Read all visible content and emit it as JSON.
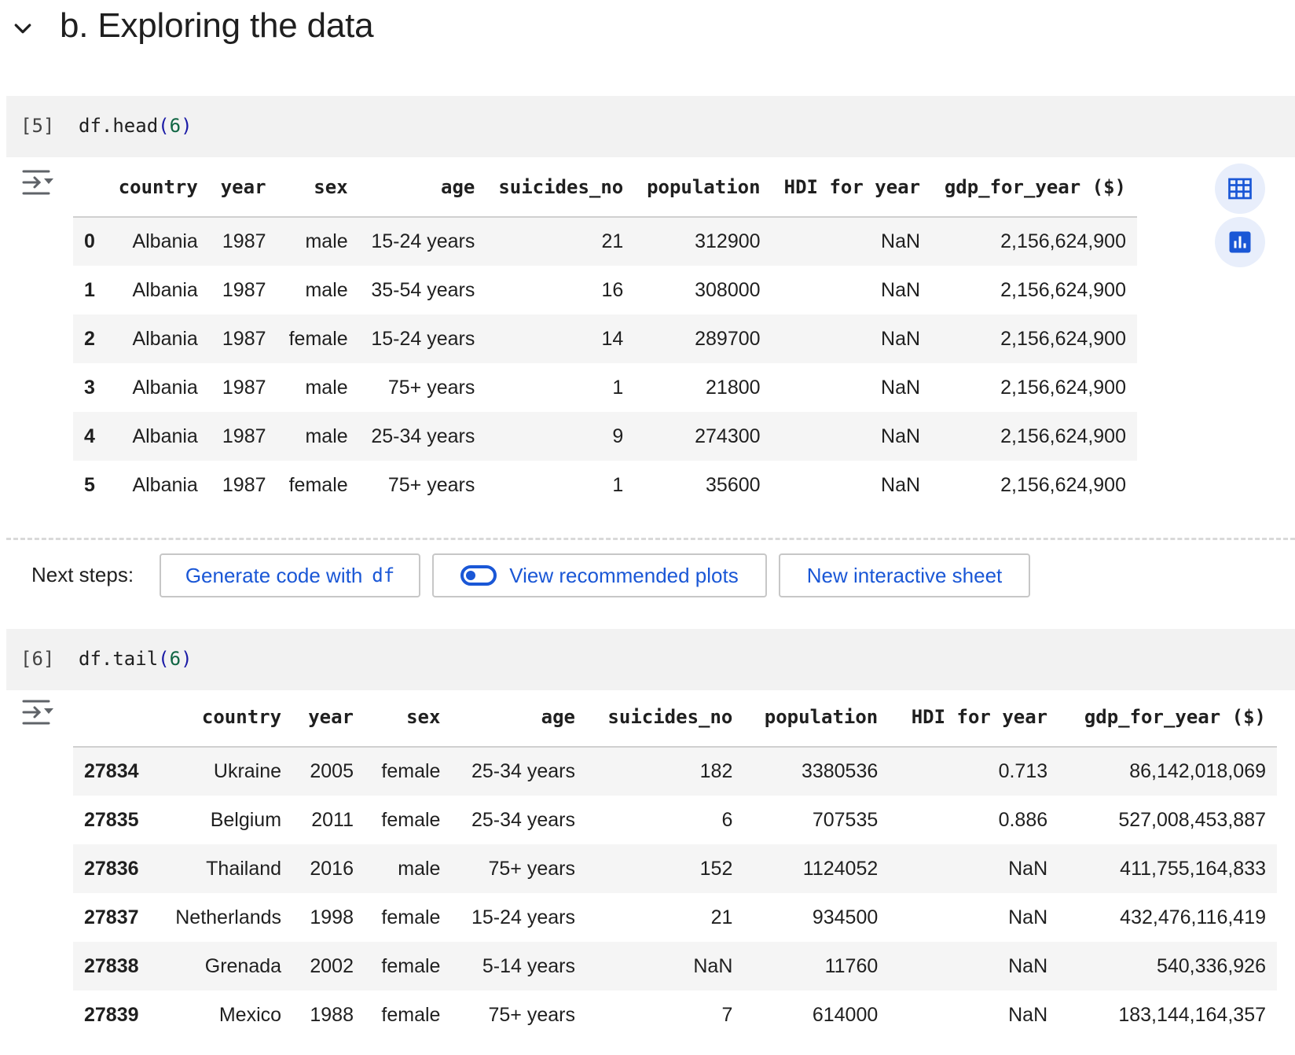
{
  "section": {
    "title": "b. Exploring the data"
  },
  "cells": [
    {
      "exec_count": "[5]",
      "code": {
        "obj": "df",
        "method": "head",
        "arg": "6"
      },
      "table": {
        "columns": [
          "",
          "country",
          "year",
          "sex",
          "age",
          "suicides_no",
          "population",
          "HDI for year",
          "gdp_for_year ($)"
        ],
        "rows": [
          [
            "0",
            "Albania",
            "1987",
            "male",
            "15-24 years",
            "21",
            "312900",
            "NaN",
            "2,156,624,900"
          ],
          [
            "1",
            "Albania",
            "1987",
            "male",
            "35-54 years",
            "16",
            "308000",
            "NaN",
            "2,156,624,900"
          ],
          [
            "2",
            "Albania",
            "1987",
            "female",
            "15-24 years",
            "14",
            "289700",
            "NaN",
            "2,156,624,900"
          ],
          [
            "3",
            "Albania",
            "1987",
            "male",
            "75+ years",
            "1",
            "21800",
            "NaN",
            "2,156,624,900"
          ],
          [
            "4",
            "Albania",
            "1987",
            "male",
            "25-34 years",
            "9",
            "274300",
            "NaN",
            "2,156,624,900"
          ],
          [
            "5",
            "Albania",
            "1987",
            "female",
            "75+ years",
            "1",
            "35600",
            "NaN",
            "2,156,624,900"
          ]
        ]
      }
    },
    {
      "exec_count": "[6]",
      "code": {
        "obj": "df",
        "method": "tail",
        "arg": "6"
      },
      "table": {
        "columns": [
          "",
          "country",
          "year",
          "sex",
          "age",
          "suicides_no",
          "population",
          "HDI for year",
          "gdp_for_year ($)"
        ],
        "rows": [
          [
            "27834",
            "Ukraine",
            "2005",
            "female",
            "25-34 years",
            "182",
            "3380536",
            "0.713",
            "86,142,018,069"
          ],
          [
            "27835",
            "Belgium",
            "2011",
            "female",
            "25-34 years",
            "6",
            "707535",
            "0.886",
            "527,008,453,887"
          ],
          [
            "27836",
            "Thailand",
            "2016",
            "male",
            "75+ years",
            "152",
            "1124052",
            "NaN",
            "411,755,164,833"
          ],
          [
            "27837",
            "Netherlands",
            "1998",
            "female",
            "15-24 years",
            "21",
            "934500",
            "NaN",
            "432,476,116,419"
          ],
          [
            "27838",
            "Grenada",
            "2002",
            "female",
            "5-14 years",
            "NaN",
            "11760",
            "NaN",
            "540,336,926"
          ],
          [
            "27839",
            "Mexico",
            "1988",
            "female",
            "75+ years",
            "7",
            "614000",
            "NaN",
            "183,144,164,357"
          ]
        ]
      }
    }
  ],
  "next_steps": {
    "label": "Next steps:",
    "generate_code": "Generate code with",
    "generate_code_var": "df",
    "view_plots": "View recommended plots",
    "new_sheet": "New interactive sheet"
  },
  "icons": {
    "collapse": "chevron-down-icon",
    "output_toggle": "output-collapse-icon",
    "table_view": "table-icon",
    "chart_view": "bar-chart-icon",
    "plots_toggle": "toggle-icon"
  },
  "colors": {
    "accent": "#1a57d6",
    "cell_bg": "#f2f2f2",
    "stripe": "#f5f5f5"
  }
}
